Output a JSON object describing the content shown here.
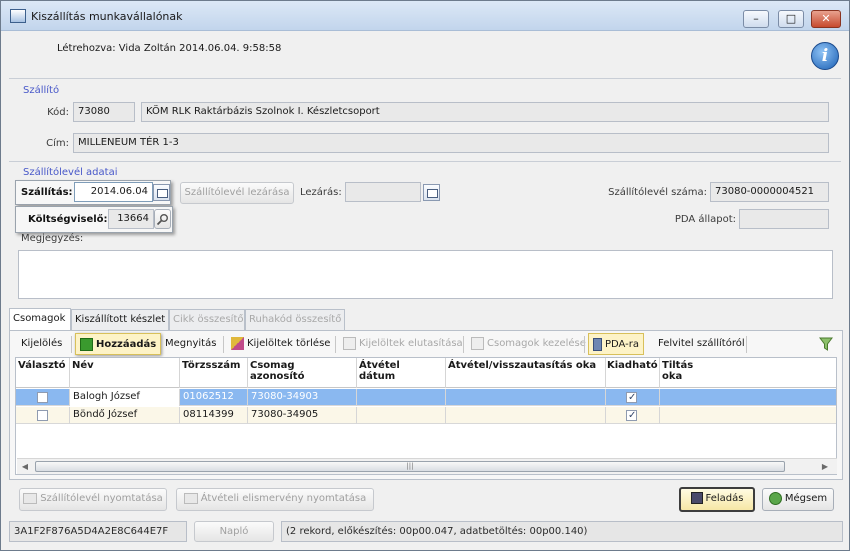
{
  "window": {
    "title": "Kiszállítás munkavállalónak",
    "minimize": "–",
    "maximize": "□",
    "close": "✕"
  },
  "created": "Létrehozva: Vida Zoltán 2014.06.04. 9:58:58",
  "supplier": {
    "group_label": "Szállító",
    "code_label": "Kód:",
    "code": "73080",
    "name": "KÖM RLK Raktárbázis Szolnok I. Készletcsoport",
    "address_label": "Cím:",
    "address": "MILLENEUM TÉR 1-3"
  },
  "delivery": {
    "group_label": "Szállítólevél adatai",
    "ship_label": "Szállítás:",
    "ship_date": "2014.06.04",
    "close_button": "Szállítólevél lezárása",
    "closed_label": "Lezárás:",
    "closed_date": "",
    "number_label": "Szállítólevél száma:",
    "number": "73080-0000004521",
    "cost_label": "Költségviselő:",
    "cost": "13664",
    "pda_label": "PDA állapot:",
    "pda_state": "",
    "note_label": "Megjegyzés:"
  },
  "tabs": [
    {
      "label": "Csomagok",
      "state": "active"
    },
    {
      "label": "Kiszállított készlet",
      "state": "normal"
    },
    {
      "label": "Cikk összesítő",
      "state": "disabled"
    },
    {
      "label": "Ruhakód összesítő",
      "state": "disabled"
    }
  ],
  "toolbar": {
    "select": "Kijelölés",
    "add": "Hozzáadás",
    "open": "Megnyitás",
    "delete_selected": "Kijelöltek törlése",
    "reject_selected": "Kijelöltek elutasítása",
    "manage_packages": "Csomagok kezelése",
    "pda": "PDA-ra",
    "from_supplier": "Felvitel szállítóról"
  },
  "grid": {
    "headers": [
      "Választó",
      "Név",
      "Törzsszám",
      "Csomag azonosító",
      "Átvétel dátum",
      "Átvétel/visszautasítás oka",
      "Kiadható",
      "Tiltás oka"
    ],
    "rows": [
      {
        "checked": false,
        "name": "Balogh József",
        "id": "01062512",
        "package": "73080-34903",
        "date": "",
        "reason": "",
        "issuable": true,
        "ban": ""
      },
      {
        "checked": false,
        "name": "Böndő József",
        "id": "08114399",
        "package": "73080-34905",
        "date": "",
        "reason": "",
        "issuable": true,
        "ban": ""
      }
    ]
  },
  "bottom_buttons": {
    "print_delivery": "Szállítólevél nyomtatása",
    "print_receipt": "Átvételi elismervény nyomtatása",
    "submit": "Feladás",
    "cancel": "Mégsem"
  },
  "status": {
    "guid": "3A1F2F876A5D4A2E8C644E7F",
    "log": "Napló",
    "info": "(2 rekord, előkészítés: 00p00.047, adatbetöltés: 00p00.140)"
  }
}
